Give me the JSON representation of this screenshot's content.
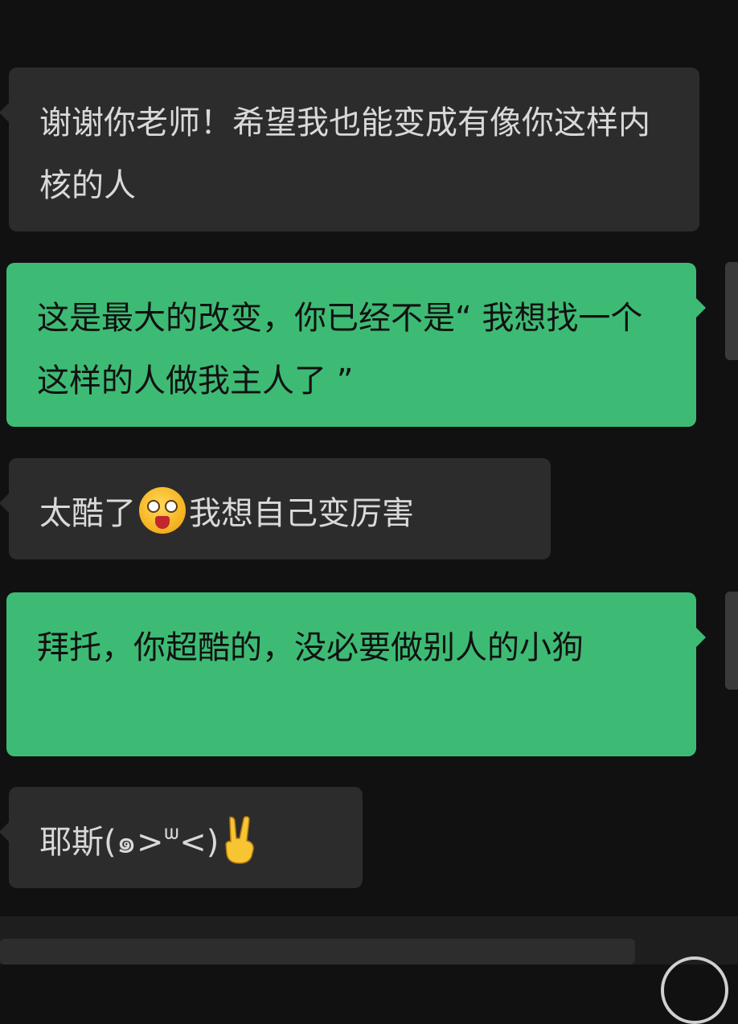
{
  "conversation": {
    "messages": [
      {
        "side": "received",
        "text": "谢谢你老师！希望我也能变成有像你这样内核的人"
      },
      {
        "side": "sent",
        "text": "这是最大的改变，你已经不是“ 我想找一个这样的人做我主人了 ”"
      },
      {
        "side": "received",
        "text_before": "太酷了",
        "emoji": "star-struck-emoji",
        "text_after": "我想自己变厉害"
      },
      {
        "side": "sent",
        "text": "拜托，你超酷的，没必要做别人的小狗"
      },
      {
        "side": "received",
        "text": "耶斯(๑>ᐜ<)",
        "emoji": "victory-hand-emoji"
      }
    ]
  },
  "colors": {
    "background": "#111111",
    "received_bubble": "#2c2c2c",
    "sent_bubble": "#3dbb74",
    "received_text": "#d9d9d9",
    "sent_text": "#111111"
  }
}
